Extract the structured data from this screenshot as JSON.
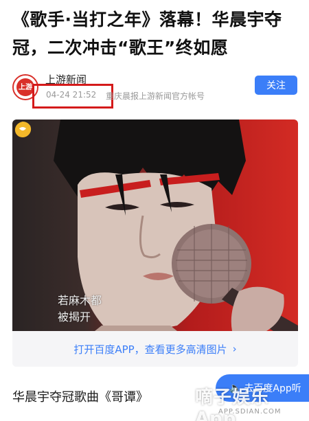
{
  "article": {
    "headline": "《歌手·当打之年》落幕！华晨宇夺冠，二次冲击“歌王”终如愿",
    "author": {
      "name": "上游新闻",
      "avatar_text": "上游",
      "publish_time": "04-24 21:52",
      "description": "重庆晨报上游新闻官方帐号",
      "follow_label": "关注"
    },
    "image": {
      "caption_line1": "若麻木都",
      "caption_line2": "被揭开",
      "open_app_label": "打开百度APP，查看更多高清图片",
      "chevron": "›"
    },
    "section_title": "华晨宇夺冠歌曲《哥谭》"
  },
  "floating": {
    "listen_label": "去百度App听",
    "speaker_icon": "🔈"
  },
  "watermark": {
    "text": "嘀子娱乐App",
    "url": "APP.SDIAN.COM"
  },
  "colors": {
    "accent": "#3b7ef8",
    "brand_red": "#d9302a",
    "highlight_box": "#d41a1a"
  }
}
